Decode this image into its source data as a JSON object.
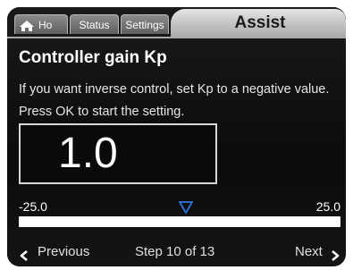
{
  "tabs": {
    "home_label": "Ho",
    "status_label": "Status",
    "settings_label": "Settings",
    "assist_label": "Assist"
  },
  "page": {
    "title": "Controller gain Kp",
    "description": "If you want inverse control, set Kp to a negative value. Press OK to start the setting."
  },
  "setting": {
    "value": "1.0",
    "min_label": "-25.0",
    "max_label": "25.0",
    "marker_position": 0.52
  },
  "footer": {
    "previous_label": "Previous",
    "step_label": "Step 10 of 13",
    "next_label": "Next"
  },
  "icons": {
    "home": "home-icon",
    "previous": "chevron-left-icon",
    "next": "chevron-right-icon",
    "marker": "triangle-down-icon"
  },
  "colors": {
    "background": "#0d0d0d",
    "marker": "#2c6bd0",
    "assist_tab": "#c7c7c7"
  }
}
